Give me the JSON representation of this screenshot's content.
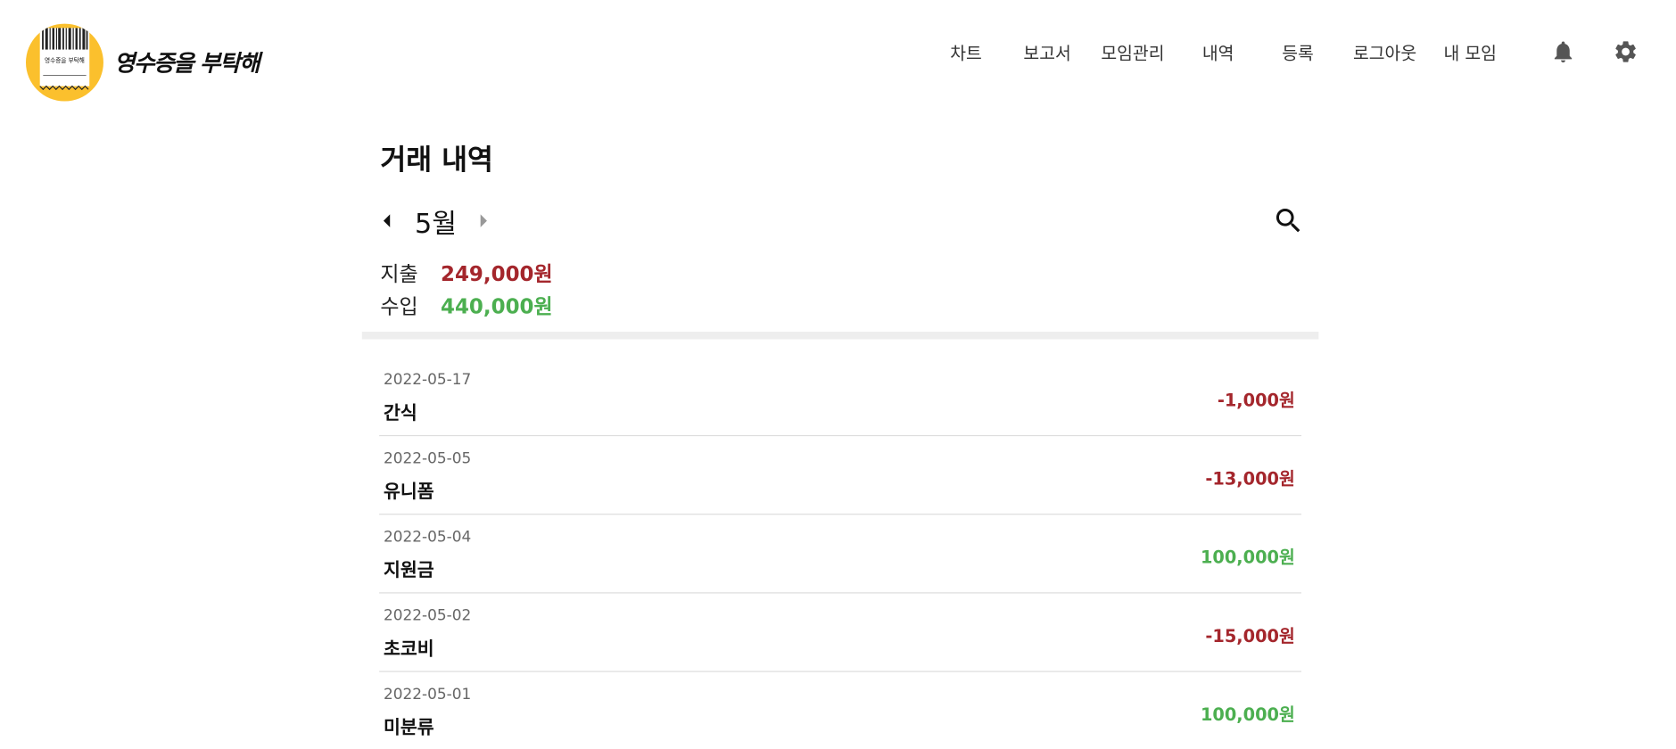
{
  "header": {
    "logo_text": "영수증을 부탁해",
    "logo_badge_text": "영수증을 부탁해",
    "brand_color": "#fbc02d",
    "nav": [
      {
        "label": "차트"
      },
      {
        "label": "보고서"
      },
      {
        "label": "모임관리"
      },
      {
        "label": "내역"
      },
      {
        "label": "등록"
      },
      {
        "label": "로그아웃"
      },
      {
        "label": "내 모임"
      }
    ],
    "icons": [
      "bell-icon",
      "gear-icon"
    ]
  },
  "main": {
    "title": "거래 내역",
    "month": "5월",
    "summary": {
      "expense_label": "지출",
      "expense_amount": "249,000원",
      "income_label": "수입",
      "income_amount": "440,000원"
    },
    "colors": {
      "expense": "#a4262c",
      "income": "#4caf50"
    },
    "transactions": [
      {
        "date": "2022-05-17",
        "name": "간식",
        "amount": "-1,000원",
        "type": "expense"
      },
      {
        "date": "2022-05-05",
        "name": "유니폼",
        "amount": "-13,000원",
        "type": "expense"
      },
      {
        "date": "2022-05-04",
        "name": "지원금",
        "amount": "100,000원",
        "type": "income"
      },
      {
        "date": "2022-05-02",
        "name": "초코비",
        "amount": "-15,000원",
        "type": "expense"
      },
      {
        "date": "2022-05-01",
        "name": "미분류",
        "amount": "100,000원",
        "type": "income"
      }
    ]
  }
}
